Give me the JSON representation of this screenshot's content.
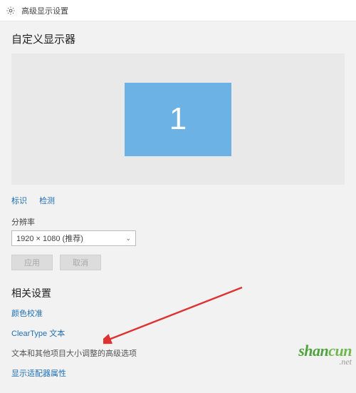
{
  "titlebar": {
    "title": "高级显示设置"
  },
  "main": {
    "section_title": "自定义显示器",
    "monitor_id": "1",
    "identify_label": "标识",
    "detect_label": "检测",
    "resolution_label": "分辨率",
    "resolution_value": "1920 × 1080 (推荐)",
    "apply_btn": "应用",
    "cancel_btn": "取消"
  },
  "related": {
    "title": "相关设置",
    "color_calibration": "颜色校准",
    "cleartype": "ClearType 文本",
    "advanced_sizing": "文本和其他项目大小调整的高级选项",
    "adapter_props": "显示适配器属性"
  },
  "watermark": {
    "line1_a": "shan",
    "line1_b": "cun",
    "line2": ".net"
  }
}
